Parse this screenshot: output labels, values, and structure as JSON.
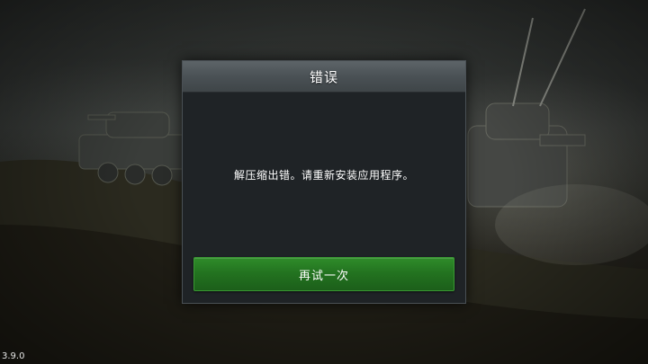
{
  "dialog": {
    "title": "错误",
    "message": "解压缩出错。请重新安装应用程序。",
    "retry_label": "再试一次"
  },
  "version": "3.9.0",
  "background": {
    "scene": "tanks on hillside"
  },
  "colors": {
    "button_green": "#237320",
    "header_gray": "#4a5155",
    "panel_dark": "#1f2326"
  }
}
